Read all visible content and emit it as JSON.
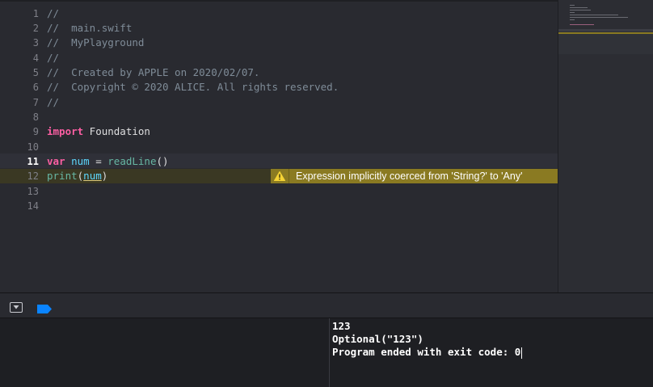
{
  "editor": {
    "line_numbers": [
      "1",
      "2",
      "3",
      "4",
      "5",
      "6",
      "7",
      "8",
      "9",
      "10",
      "11",
      "12",
      "13",
      "14"
    ],
    "current_line": "11",
    "comments": {
      "l1": "//",
      "l2": "//  main.swift",
      "l3": "//  MyPlayground",
      "l4": "//",
      "l5": "//  Created by APPLE on 2020/02/07.",
      "l6": "//  Copyright © 2020 ALICE. All rights reserved.",
      "l7": "//"
    },
    "line9": {
      "keyword": "import",
      "module": " Foundation"
    },
    "line11": {
      "keyword": "var",
      "name": "num",
      "op": " = ",
      "call": "readLine",
      "parens": "()"
    },
    "line12": {
      "call": "print",
      "open": "(",
      "arg": "num",
      "close": ")"
    }
  },
  "warning": {
    "icon": "warning-triangle-icon",
    "message": "Expression implicitly coerced from 'String?' to 'Any'"
  },
  "debug_bar": {
    "hide_icon": "hide-debug-area-icon",
    "breakpoint_icon": "breakpoint-toggle-icon"
  },
  "console": {
    "lines": [
      "123",
      "Optional(\"123\")",
      "Program ended with exit code: 0"
    ]
  },
  "colors": {
    "editor_bg": "#292a30",
    "keyword": "#fc5fa3",
    "comment": "#7f8c98",
    "function": "#67b7a4",
    "identifier": "#5dd8ff",
    "warning_bg": "#8a7a22",
    "breakpoint": "#0a84ff"
  }
}
